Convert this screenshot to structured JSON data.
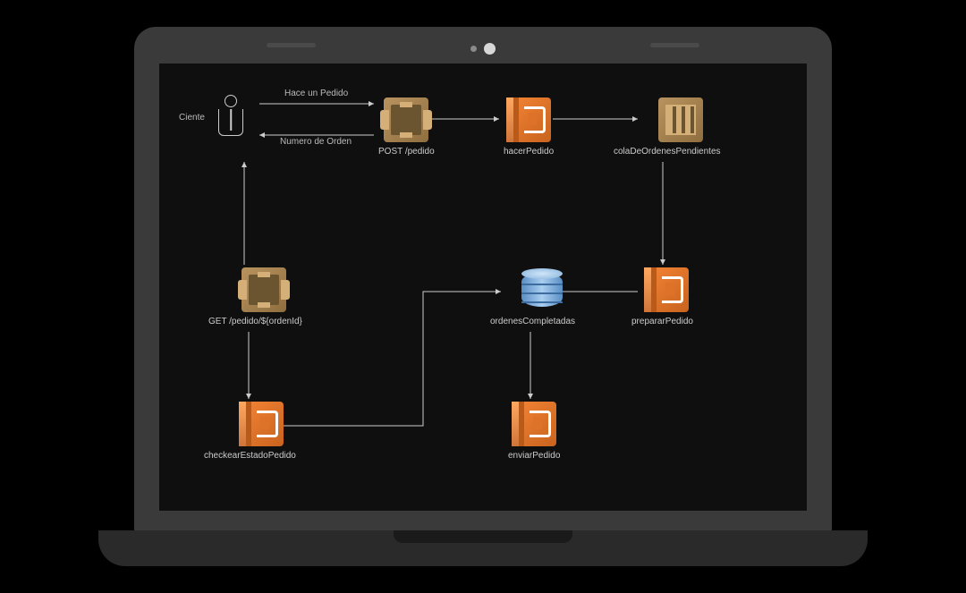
{
  "diagram": {
    "nodes": {
      "client": {
        "label": "Ciente",
        "type": "user"
      },
      "postPedido": {
        "label": "POST /pedido",
        "type": "apigateway"
      },
      "hacerPedido": {
        "label": "hacerPedido",
        "type": "lambda"
      },
      "colaPendientes": {
        "label": "colaDeOrdenesPendientes",
        "type": "sqs"
      },
      "getPedido": {
        "label": "GET /pedido/${ordenId}",
        "type": "apigateway"
      },
      "ordenesCompletadas": {
        "label": "ordenesCompletadas",
        "type": "dynamodb"
      },
      "prepararPedido": {
        "label": "prepararPedido",
        "type": "lambda"
      },
      "checkearEstado": {
        "label": "checkearEstadoPedido",
        "type": "lambda"
      },
      "enviarPedido": {
        "label": "enviarPedido",
        "type": "lambda"
      }
    },
    "edges": {
      "haceUnPedido": "Hace un Pedido",
      "numeroDeOrden": "Numero de Orden"
    }
  }
}
